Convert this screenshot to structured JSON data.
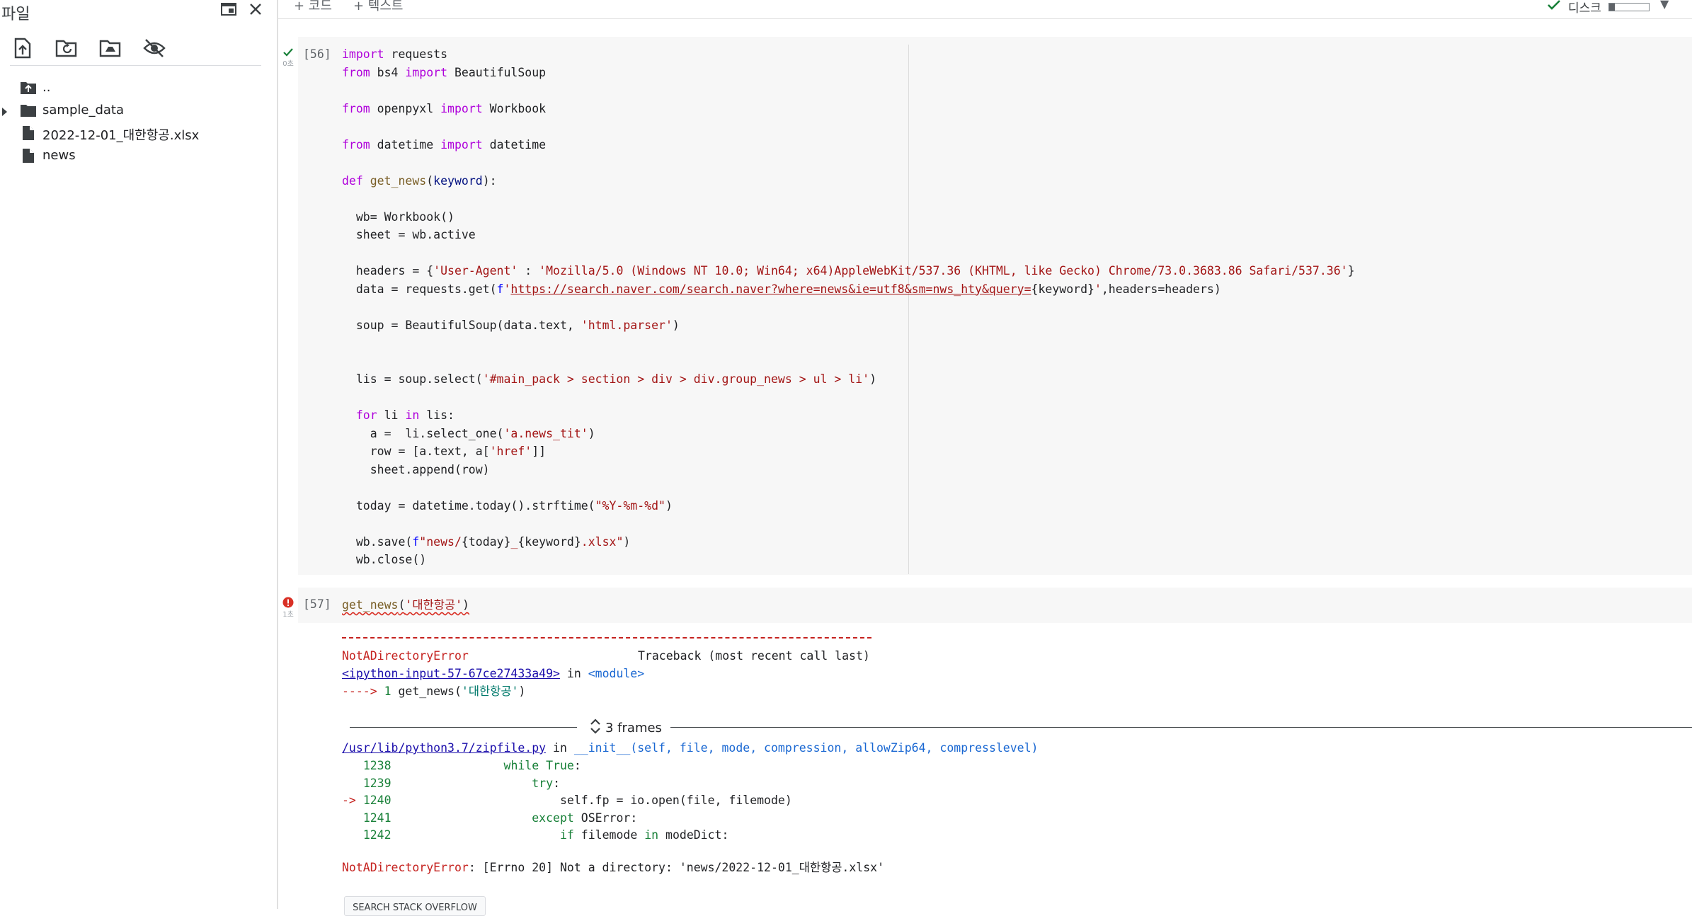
{
  "sidebar": {
    "title": "파일",
    "files": [
      {
        "name": ".."
      },
      {
        "name": "sample_data"
      },
      {
        "name": "2022-12-01_대한항공.xlsx"
      },
      {
        "name": "news"
      }
    ]
  },
  "topbar": {
    "add_code": "+ 코드",
    "add_text": "+ 텍스트",
    "disk_label": "디스크",
    "disk_usage_fraction": 0.15
  },
  "cell56": {
    "exec_count": "[56]",
    "exec_time": "0초",
    "code": [
      "import requests",
      "from bs4 import BeautifulSoup",
      "",
      "from openpyxl import Workbook",
      "",
      "from datetime import datetime",
      "",
      "def get_news(keyword):",
      "",
      "  wb= Workbook()",
      "  sheet = wb.active",
      "",
      "  headers = {'User-Agent' : 'Mozilla/5.0 (Windows NT 10.0; Win64; x64)AppleWebKit/537.36 (KHTML, like Gecko) Chrome/73.0.3683.86 Safari/537.36'}",
      "  data = requests.get(f'https://search.naver.com/search.naver?where=news&ie=utf8&sm=nws_hty&query={keyword}',headers=headers)",
      "",
      "  soup = BeautifulSoup(data.text, 'html.parser')",
      "",
      "",
      "  lis = soup.select('#main_pack > section > div > div.group_news > ul > li')",
      "",
      "  for li in lis:",
      "    a =  li.select_one('a.news_tit')",
      "    row = [a.text, a['href']]",
      "    sheet.append(row)",
      "",
      "  today = datetime.today().strftime(\"%Y-%m-%d\")",
      "",
      "  wb.save(f\"news/{today}_{keyword}.xlsx\")",
      "  wb.close()"
    ]
  },
  "cell57": {
    "exec_count": "[57]",
    "exec_time": "1초",
    "code": "get_news('대한항공')",
    "output": {
      "error_name": "NotADirectoryError",
      "traceback_header": "Traceback (most recent call last)",
      "input_link": "<ipython-input-57-67ce27433a49>",
      "in_module_in": " in ",
      "in_module": "<module>",
      "arrow_line": "----> 1 get_news('대한항공')",
      "frames_label": "3 frames",
      "zip_link": "/usr/lib/python3.7/zipfile.py",
      "zip_in": " in ",
      "zip_func": "__init__(self, file, mode, compression, allowZip64, compresslevel)",
      "frame_lines": [
        {
          "num": "   1238",
          "code": "                while True:"
        },
        {
          "num": "   1239",
          "code": "                    try:"
        },
        {
          "num": "-> 1240",
          "code": "                        self.fp = io.open(file, filemode)"
        },
        {
          "num": "   1241",
          "code": "                    except OSError:"
        },
        {
          "num": "   1242",
          "code": "                        if filemode in modeDict:"
        }
      ],
      "final_error": "NotADirectoryError",
      "final_message": ": [Errno 20] Not a directory: 'news/2022-12-01_대한항공.xlsx'",
      "search_button": "SEARCH STACK OVERFLOW"
    }
  },
  "colors": {
    "keyword": "#af00db",
    "builtin": "#0000ff",
    "function": "#795e26",
    "param": "#001080",
    "string": "#a31515",
    "success": "#188038",
    "error": "#d93025",
    "cell_bg": "#f7f7f7"
  }
}
